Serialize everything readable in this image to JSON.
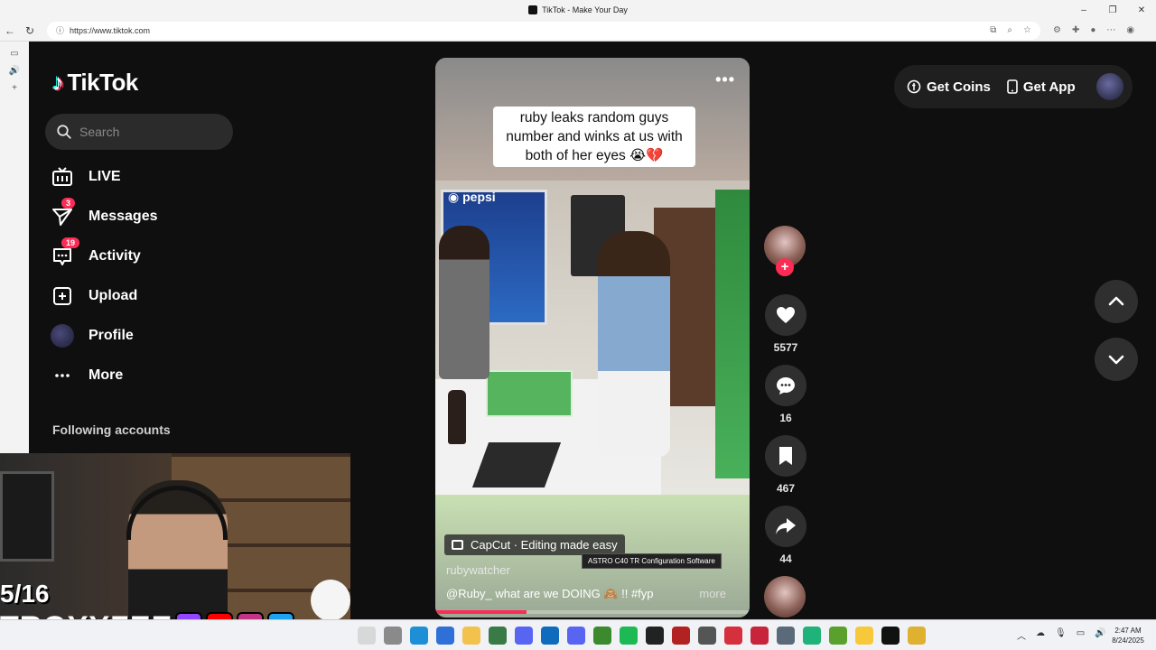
{
  "window": {
    "title": "TikTok - Make Your Day"
  },
  "browser": {
    "url": "https://www.tiktok.com"
  },
  "sidebar": {
    "logo": "TikTok",
    "search_placeholder": "Search",
    "items": [
      {
        "label": "LIVE",
        "icon": "live-icon"
      },
      {
        "label": "Messages",
        "icon": "messages-icon",
        "badge": "3"
      },
      {
        "label": "Activity",
        "icon": "activity-icon",
        "badge": "19"
      },
      {
        "label": "Upload",
        "icon": "upload-icon"
      },
      {
        "label": "Profile",
        "icon": "profile-avatar"
      },
      {
        "label": "More",
        "icon": "more-icon"
      }
    ],
    "following_heading": "Following accounts"
  },
  "video": {
    "caption": "ruby leaks random guys number and winks at us with both of her eyes 😭💔",
    "capcut_label": "CapCut · Editing made easy",
    "username": "rubywatcher",
    "description": "@Ruby_ what are we DOING 🙈 !! #fyp",
    "more_label": "more",
    "progress_fraction": 0.29
  },
  "actions": {
    "likes": "5577",
    "comments": "16",
    "saves": "467",
    "shares": "44"
  },
  "topbar": {
    "coins_label": "Get Coins",
    "app_label": "Get App"
  },
  "tooltip": "ASTRO C40 TR Configuration Software",
  "webcam": {
    "counter": "5/16",
    "streamer": "TROYYZEE"
  },
  "taskbar": {
    "time": "2:47 AM",
    "date": "8/24/2025"
  },
  "colors": {
    "accent": "#fe2c55",
    "background": "#0f0f0f",
    "button": "#2f2f2f"
  }
}
